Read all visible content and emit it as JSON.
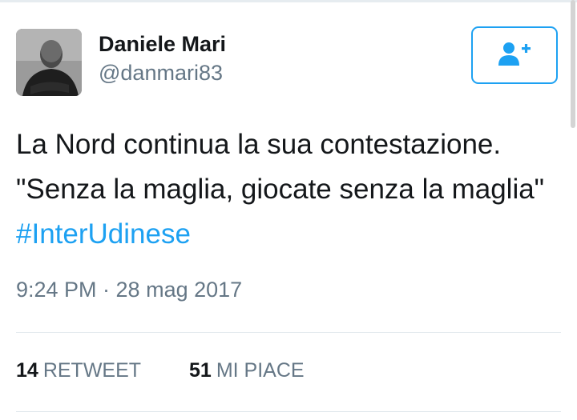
{
  "user": {
    "name": "Daniele Mari",
    "handle": "@danmari83"
  },
  "follow_button": {
    "icon": "add-user-icon"
  },
  "tweet": {
    "text": "La Nord continua la sua contestazione. \"Senza la maglia, giocate senza la maglia\"",
    "hashtag": "#InterUdinese"
  },
  "timestamp": "9:24 PM · 28 mag 2017",
  "stats": {
    "retweets": {
      "count": "14",
      "label": "RETWEET"
    },
    "likes": {
      "count": "51",
      "label": "MI PIACE"
    }
  },
  "colors": {
    "accent": "#1da1f2",
    "secondary_text": "#657786",
    "divider": "#e1e8ed"
  }
}
